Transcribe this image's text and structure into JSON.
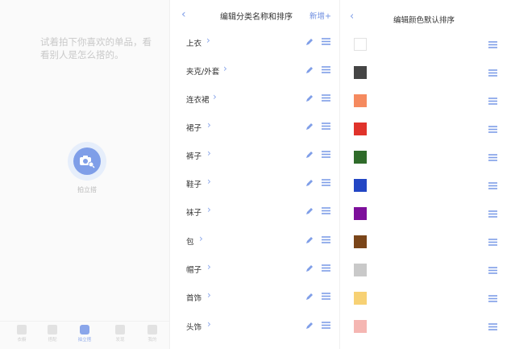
{
  "empty_panel": {
    "hint": "试着拍下你喜欢的单品，看看别人是怎么搭的。",
    "camera_label": "拍立搭",
    "tabs": [
      {
        "label": "衣橱",
        "active": false
      },
      {
        "label": "搭配",
        "active": false
      },
      {
        "label": "拍立搭",
        "active": true
      },
      {
        "label": "发现",
        "active": false
      },
      {
        "label": "我的",
        "active": false
      }
    ]
  },
  "category_editor": {
    "back_icon": "chevron-left-icon",
    "title": "编辑分类名称和排序",
    "add_label": "新增+",
    "categories": [
      "上衣",
      "夹克/外套",
      "连衣裙",
      "裙子",
      "裤子",
      "鞋子",
      "袜子",
      "包",
      "帽子",
      "首饰",
      "头饰"
    ]
  },
  "color_editor": {
    "back_icon": "chevron-left-icon",
    "title": "编辑颜色默认排序",
    "colors": [
      "#ffffff",
      "#454545",
      "#f58a5f",
      "#e0332b",
      "#2f6b2a",
      "#2346c4",
      "#7d0f9b",
      "#7a4519",
      "#c9c9c9",
      "#f7d174",
      "#f5b6b2"
    ]
  },
  "accent_color": "#7f9ee8"
}
